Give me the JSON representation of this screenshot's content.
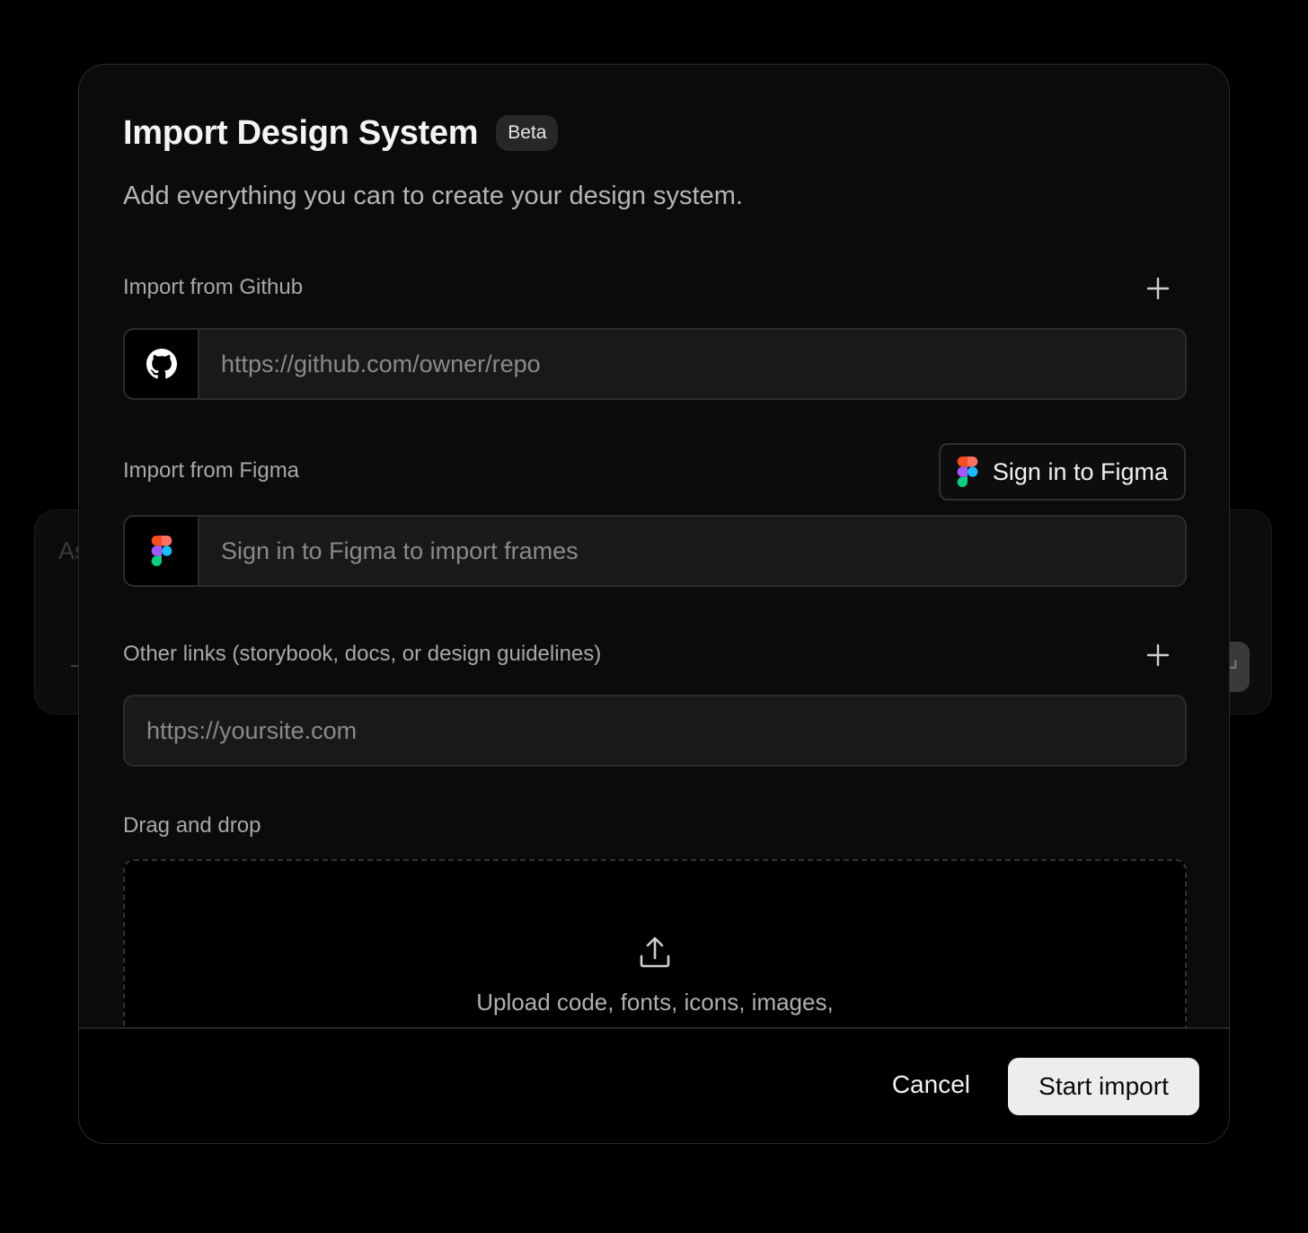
{
  "background": {
    "card_text": "As",
    "button_glyph": "↵"
  },
  "modal": {
    "title": "Import Design System",
    "badge": "Beta",
    "subtitle": "Add everything you can to create your design system."
  },
  "github": {
    "label": "Import from Github",
    "placeholder": "https://github.com/owner/repo",
    "icon": "github-icon",
    "add_icon": "plus-icon"
  },
  "figma": {
    "label": "Import from Figma",
    "signin_label": "Sign in to Figma",
    "placeholder": "Sign in to Figma to import frames",
    "icon": "figma-icon",
    "colors": [
      "#f24e1e",
      "#ff7262",
      "#a259ff",
      "#1abcfe",
      "#0acf83"
    ]
  },
  "links": {
    "label": "Other links (storybook, docs, or design guidelines)",
    "placeholder": "https://yoursite.com",
    "add_icon": "plus-icon"
  },
  "dropzone": {
    "label": "Drag and drop",
    "icon": "upload-icon",
    "text": "Upload code, fonts, icons, images,"
  },
  "footer": {
    "cancel_label": "Cancel",
    "start_label": "Start import"
  },
  "colors": {
    "page_bg": "#000000",
    "modal_bg": "#0b0b0b",
    "input_bg": "#191919",
    "border": "#2c2c2c",
    "primary_button_bg": "#ededed"
  }
}
